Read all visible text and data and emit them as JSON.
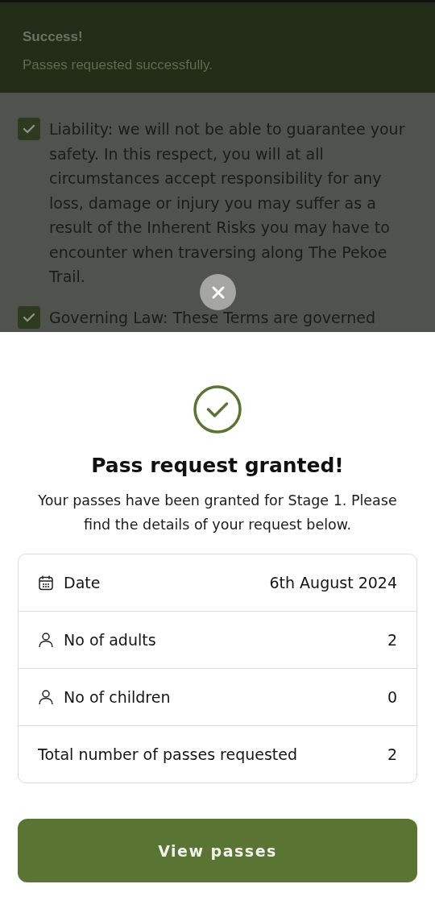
{
  "toast": {
    "title": "Success!",
    "message": "Passes requested successfully."
  },
  "terms": [
    {
      "text": "Liability: we will not be able to guarantee your safety. In this respect, you will at all circumstances accept responsibility for any loss, damage or injury you may suffer as a result of the Inherent Risks you may have to encounter when traversing along The Pekoe Trail.",
      "checked": true
    },
    {
      "text": "Governing Law: These Terms are governed",
      "checked": true
    }
  ],
  "sheet": {
    "title": "Pass request granted!",
    "message": "Your passes have been granted for Stage 1. Please find the details of your request below.",
    "details": [
      {
        "kind": "date",
        "label": "Date",
        "value": "6th August 2024"
      },
      {
        "kind": "person",
        "label": "No of adults",
        "value": "2"
      },
      {
        "kind": "person",
        "label": "No of children",
        "value": "0"
      },
      {
        "kind": "plain",
        "label": "Total number of passes requested",
        "value": "2"
      }
    ],
    "button": "View passes"
  }
}
